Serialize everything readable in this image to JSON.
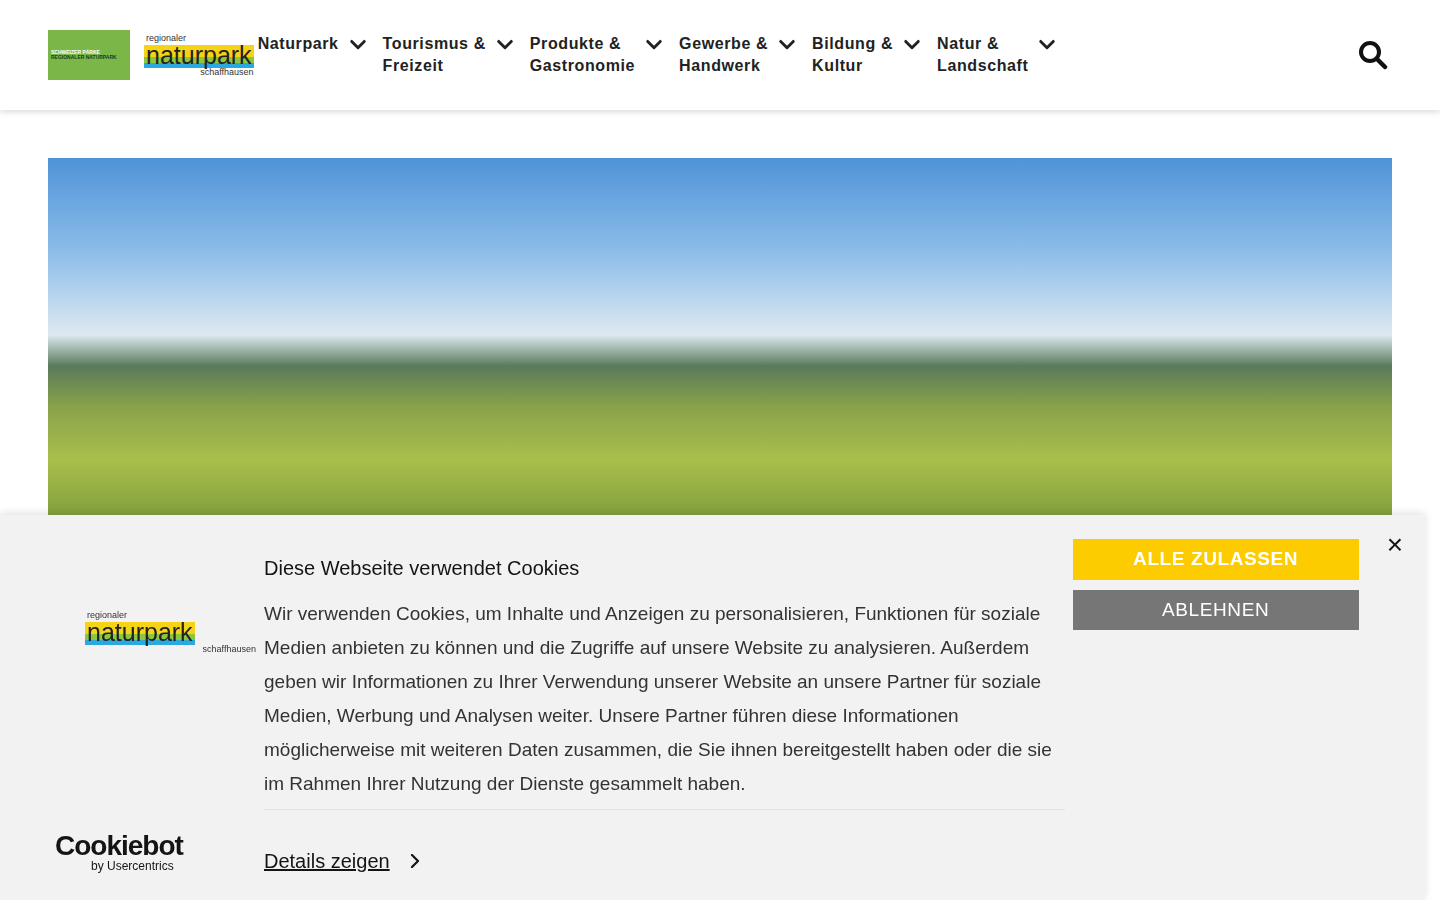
{
  "header": {
    "parks_logo": {
      "top": "SCHWEIZER PÄRKE",
      "bottom": "REGIONALER NATURPARK"
    },
    "brand": {
      "small": "regionaler",
      "name": "naturpark",
      "region": "schaffhausen"
    },
    "nav": [
      {
        "lines": [
          "Naturpark"
        ]
      },
      {
        "lines": [
          "Tourismus &",
          "Freizeit"
        ]
      },
      {
        "lines": [
          "Produkte &",
          "Gastronomie"
        ]
      },
      {
        "lines": [
          "Gewerbe &",
          "Handwerk"
        ]
      },
      {
        "lines": [
          "Bildung &",
          "Kultur"
        ]
      },
      {
        "lines": [
          "Natur &",
          "Landschaft"
        ]
      }
    ]
  },
  "cookie_banner": {
    "brand": {
      "small": "regionaler",
      "name": "naturpark",
      "region": "schaffhausen"
    },
    "provider": {
      "name": "Cookiebot",
      "by": "by Usercentrics"
    },
    "title": "Diese Webseite verwendet Cookies",
    "text": "Wir verwenden Cookies, um Inhalte und Anzeigen zu personalisieren, Funktionen für soziale Medien anbieten zu können und die Zugriffe auf unsere Website zu analysieren. Außerdem geben wir Informationen zu Ihrer Verwendung unserer Website an unsere Partner für soziale Medien, Werbung und Analysen weiter. Unsere Partner führen diese Informationen möglicherweise mit weiteren Daten zusammen, die Sie ihnen bereitgestellt haben oder die sie im Rahmen Ihrer Nutzung der Dienste gesammelt haben.",
    "details": "Details zeigen",
    "accept": "ALLE ZULASSEN",
    "decline": "ABLEHNEN",
    "close": "×"
  }
}
